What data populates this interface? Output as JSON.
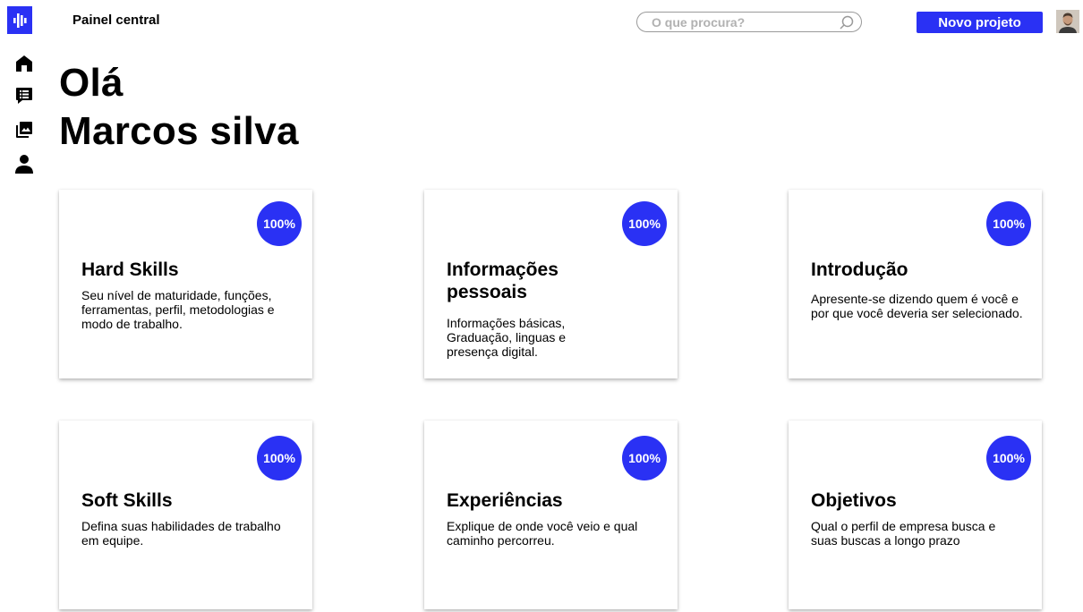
{
  "header": {
    "title": "Painel central",
    "search_placeholder": "O que procura?",
    "new_project_label": "Novo projeto"
  },
  "sidebar": {
    "items": [
      "home-icon",
      "chat-icon",
      "gallery-icon",
      "profile-icon"
    ]
  },
  "greeting": {
    "line1": "Olá",
    "line2": "Marcos silva"
  },
  "colors": {
    "accent": "#2a31f4"
  },
  "cards": [
    {
      "title": "Hard Skills",
      "progress": "100%",
      "description": "Seu nível de maturidade, funções, ferramentas, perfil, metodologias e modo de trabalho."
    },
    {
      "title": "Informações pessoais",
      "progress": "100%",
      "description": "Informações básicas, Graduação, linguas e presença digital."
    },
    {
      "title": "Introdução",
      "progress": "100%",
      "description": "Apresente-se dizendo quem é você e por que você deveria ser selecionado."
    },
    {
      "title": "Soft Skills",
      "progress": "100%",
      "description": "Defina suas habilidades de trabalho em equipe."
    },
    {
      "title": "Experiências",
      "progress": "100%",
      "description": "Explique de onde você veio e qual caminho percorreu."
    },
    {
      "title": "Objetivos",
      "progress": "100%",
      "description": "Qual o perfil de empresa busca e suas buscas a longo prazo"
    }
  ]
}
